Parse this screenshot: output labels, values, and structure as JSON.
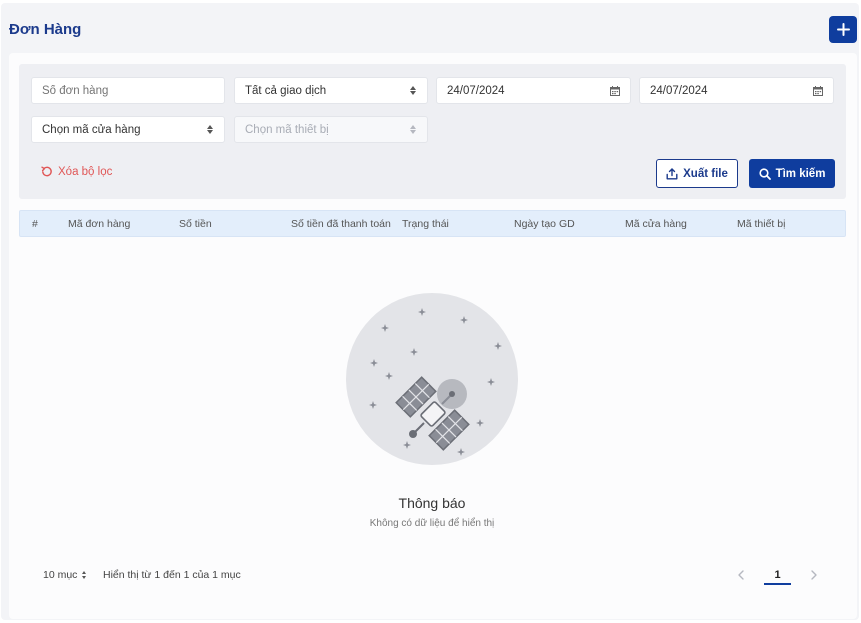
{
  "header": {
    "title": "Đơn Hàng",
    "add_icon": "plus-icon"
  },
  "filters": {
    "order_number": {
      "placeholder": "Số đơn hàng"
    },
    "transaction_type": {
      "value": "Tất cả giao dịch"
    },
    "date_from": {
      "value": "24/07/2024"
    },
    "date_to": {
      "value": "24/07/2024"
    },
    "store_code": {
      "value": "Chọn mã cửa hàng"
    },
    "device_code": {
      "value": "Chọn mã thiết bị"
    },
    "clear_label": "Xóa bộ lọc",
    "export_label": "Xuất file",
    "search_label": "Tìm kiếm"
  },
  "table": {
    "columns": [
      "#",
      "Mã đơn hàng",
      "Số tiền",
      "Số tiền đã thanh toán",
      "Trạng thái",
      "Ngày tạo GD",
      "Mã cửa hàng",
      "Mã thiết bị"
    ],
    "rows": []
  },
  "empty_state": {
    "title": "Thông báo",
    "description": "Không có dữ liệu để hiển thị"
  },
  "pagination": {
    "page_size_label": "10 mục",
    "summary": "Hiển thị từ 1 đến 1 của 1 mục",
    "current_page": "1"
  },
  "colors": {
    "primary": "#0f3d9e",
    "title": "#1b3a8c",
    "danger": "#e05656",
    "table_header_bg": "#e3eefb"
  }
}
